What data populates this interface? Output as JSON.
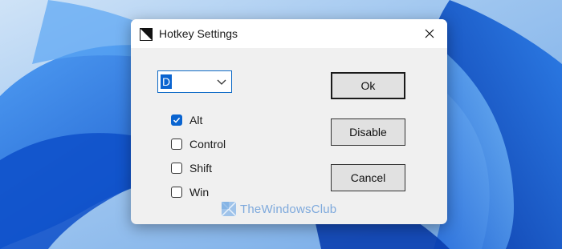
{
  "window": {
    "title": "Hotkey Settings",
    "close_icon": "close-icon"
  },
  "key_select": {
    "value": "D",
    "icon": "chevron-down-icon"
  },
  "modifiers": [
    {
      "label": "Alt",
      "checked": true
    },
    {
      "label": "Control",
      "checked": false
    },
    {
      "label": "Shift",
      "checked": false
    },
    {
      "label": "Win",
      "checked": false
    }
  ],
  "buttons": {
    "ok": "Ok",
    "disable": "Disable",
    "cancel": "Cancel"
  },
  "watermark": {
    "text": "TheWindowsClub"
  },
  "colors": {
    "accent": "#0a64d0",
    "dialog_bg": "#f0f0f0",
    "desktop": "#3a7fe0"
  }
}
